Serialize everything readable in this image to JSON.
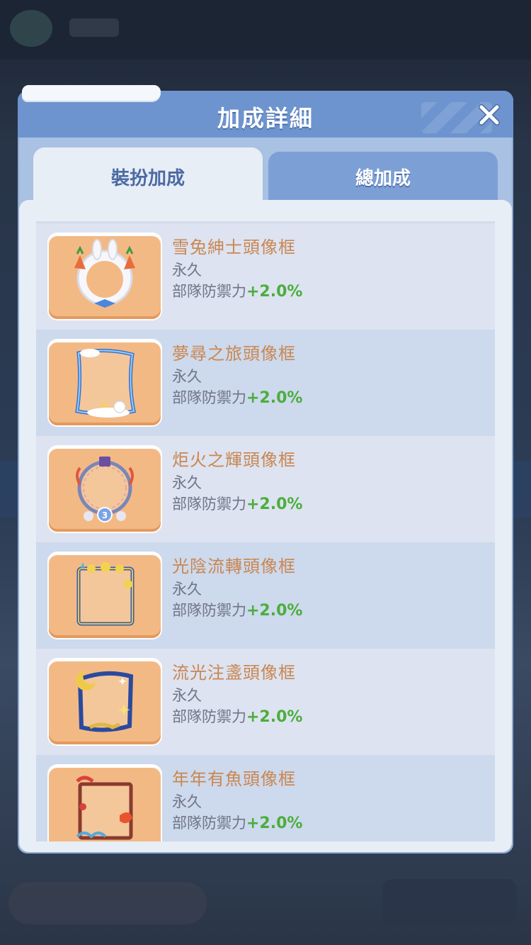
{
  "modal": {
    "title": "加成詳細",
    "close_icon": "close-icon"
  },
  "tabs": [
    {
      "label": "裝扮加成",
      "active": true
    },
    {
      "label": "總加成",
      "active": false
    }
  ],
  "items": [
    {
      "name": "雪兔紳士頭像框",
      "duration": "永久",
      "stat": "部隊防禦力",
      "bonus": "+2.0%",
      "icon": "snow-rabbit-frame-icon"
    },
    {
      "name": "夢尋之旅頭像框",
      "duration": "永久",
      "stat": "部隊防禦力",
      "bonus": "+2.0%",
      "icon": "dream-journey-frame-icon"
    },
    {
      "name": "炬火之輝頭像框",
      "duration": "永久",
      "stat": "部隊防禦力",
      "bonus": "+2.0%",
      "icon": "torch-glory-frame-icon"
    },
    {
      "name": "光陰流轉頭像框",
      "duration": "永久",
      "stat": "部隊防禦力",
      "bonus": "+2.0%",
      "icon": "time-flow-frame-icon"
    },
    {
      "name": "流光注盞頭像框",
      "duration": "永久",
      "stat": "部隊防禦力",
      "bonus": "+2.0%",
      "icon": "lamp-light-frame-icon"
    },
    {
      "name": "年年有魚頭像框",
      "duration": "永久",
      "stat": "部隊防禦力",
      "bonus": "+2.0%",
      "icon": "koi-fish-frame-icon"
    }
  ],
  "colors": {
    "accent": "#6e94cf",
    "item_name": "#c98651",
    "bonus_green": "#4bae3c"
  }
}
